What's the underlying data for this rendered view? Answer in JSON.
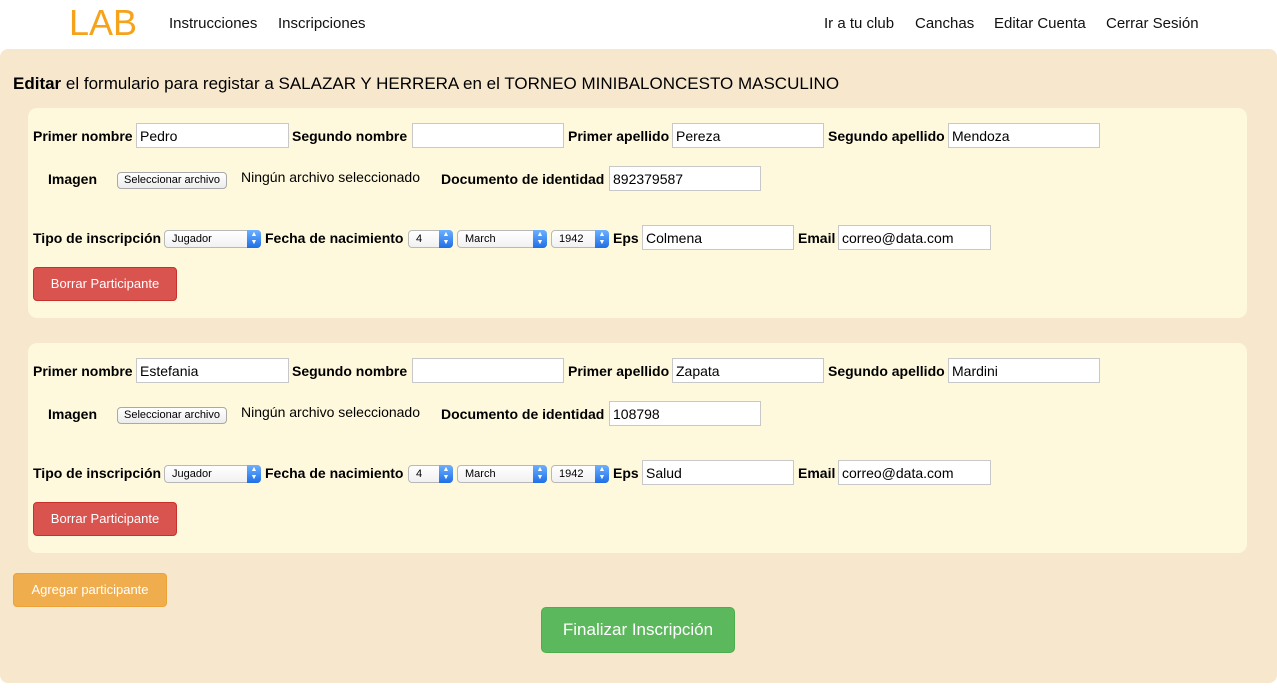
{
  "nav": {
    "brand": "LAB",
    "left_links": [
      "Instrucciones",
      "Inscripciones"
    ],
    "right_links": [
      "Ir a tu club",
      "Canchas",
      "Editar Cuenta",
      "Cerrar Sesión"
    ]
  },
  "page": {
    "title_bold": "Editar",
    "title_rest": " el formulario para registar a SALAZAR Y HERRERA en el TORNEO MINIBALONCESTO MASCULINO"
  },
  "labels": {
    "primer_nombre": "Primer nombre",
    "segundo_nombre": "Segundo nombre",
    "primer_apellido": "Primer apellido",
    "segundo_apellido": "Segundo apellido",
    "imagen": "Imagen",
    "file_button": "Seleccionar archivo",
    "file_status": "Ningún archivo seleccionado",
    "documento": "Documento de identidad",
    "tipo": "Tipo de inscripción",
    "fecha": "Fecha de nacimiento",
    "eps": "Eps",
    "email": "Email",
    "borrar": "Borrar Participante"
  },
  "participants": [
    {
      "primer_nombre": "Pedro",
      "segundo_nombre": "",
      "primer_apellido": "Pereza",
      "segundo_apellido": "Mendoza",
      "documento": "892379587",
      "tipo": "Jugador",
      "dia": "4",
      "mes": "March",
      "anio": "1942",
      "eps": "Colmena",
      "email": "correo@data.com"
    },
    {
      "primer_nombre": "Estefania",
      "segundo_nombre": "",
      "primer_apellido": "Zapata",
      "segundo_apellido": "Mardini",
      "documento": "108798",
      "tipo": "Jugador",
      "dia": "4",
      "mes": "March",
      "anio": "1942",
      "eps": "Salud",
      "email": "correo@data.com"
    }
  ],
  "actions": {
    "agregar": "Agregar participante",
    "finalizar": "Finalizar Inscripción"
  },
  "colors": {
    "brand": "#f5a31a",
    "panel_bg": "#f7e8cd",
    "card_bg": "#fef8dc",
    "danger": "#d9534f",
    "warning": "#f0ad4e",
    "success": "#5cb85c"
  }
}
